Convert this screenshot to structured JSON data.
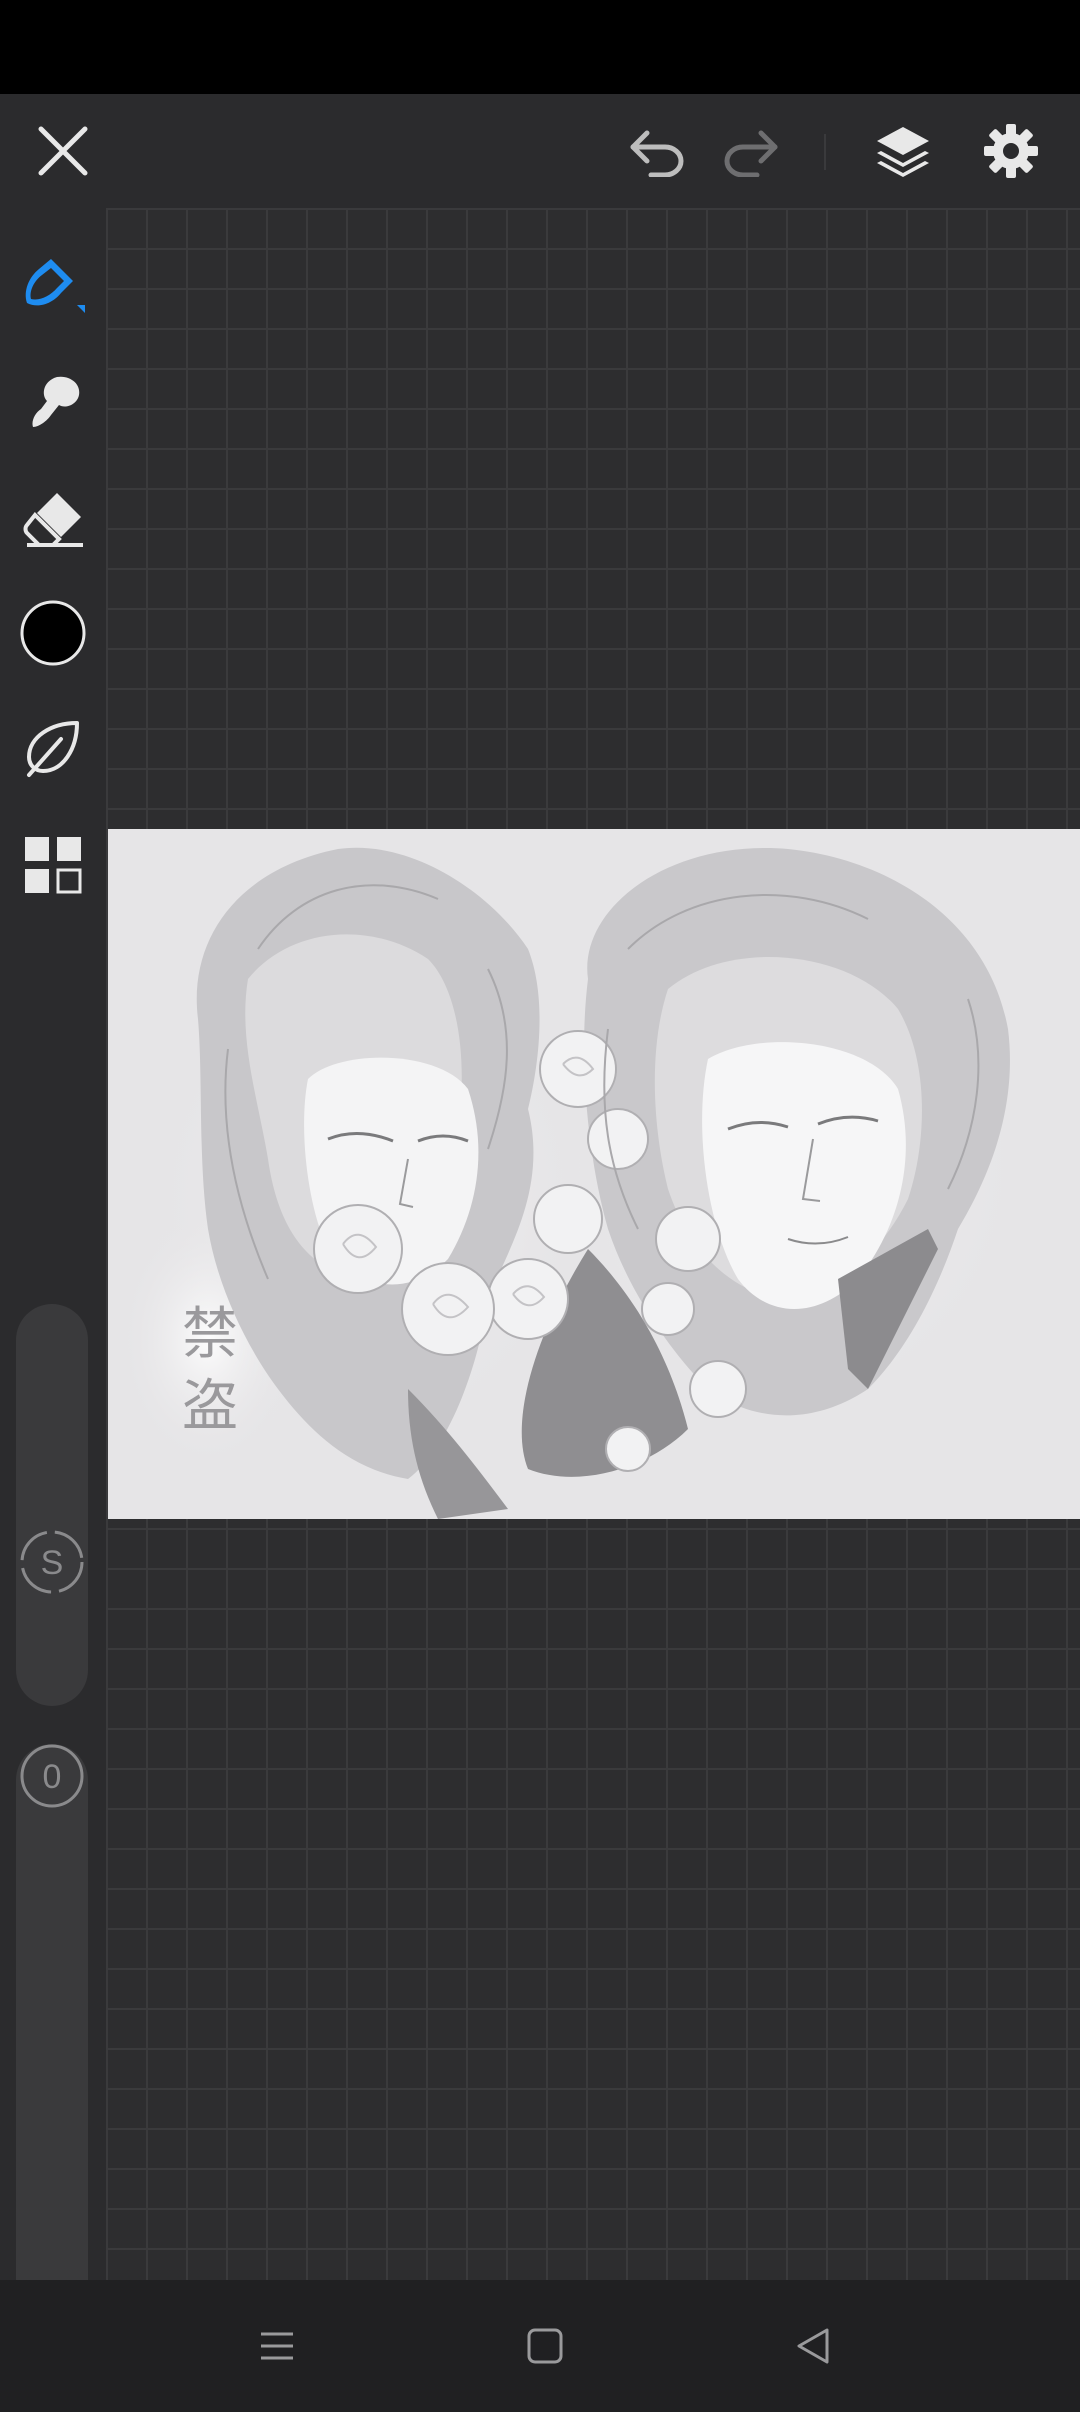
{
  "app": {
    "name": "drawing canvas"
  },
  "toolbar": {
    "close_icon": "close-icon",
    "undo_icon": "undo-icon",
    "redo_icon": "redo-icon",
    "layers_icon": "layers-icon",
    "settings_icon": "gear-icon"
  },
  "sidebar": {
    "tools": [
      {
        "name": "pen-tool",
        "icon": "pen-icon",
        "active": true
      },
      {
        "name": "smudge-tool",
        "icon": "smudge-icon",
        "active": false
      },
      {
        "name": "eraser-tool",
        "icon": "eraser-icon",
        "active": false
      },
      {
        "name": "color-swatch",
        "icon": "color-circle-icon",
        "color": "#000000"
      },
      {
        "name": "lasso-tool",
        "icon": "lasso-icon",
        "active": false
      },
      {
        "name": "more-tools",
        "icon": "grid-icon",
        "active": false
      }
    ],
    "size_slider": {
      "label": "S"
    },
    "opacity_slider": {
      "label": "0"
    }
  },
  "artwork": {
    "caption": "禁\n盗"
  },
  "colors": {
    "accent": "#1e8cf0",
    "toolbar_bg": "#2b2b2d",
    "canvas_bg": "#2d2d2f",
    "grid": "#3a3a3c",
    "artwork_bg": "#e6e5e7"
  },
  "nav": {
    "menu_icon": "menu-icon",
    "home_icon": "home-icon",
    "back_icon": "back-icon"
  }
}
